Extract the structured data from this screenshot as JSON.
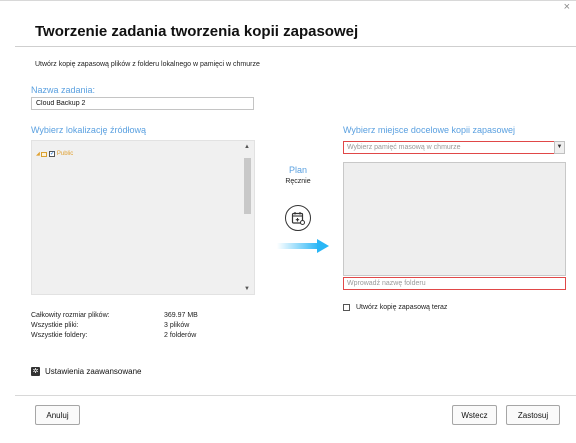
{
  "dialog": {
    "title": "Tworzenie zadania tworzenia kopii zapasowej",
    "subtitle": "Utwórz kopię zapasową plików z folderu lokalnego w pamięci w chmurze"
  },
  "task_name": {
    "label": "Nazwa zadania:",
    "value": "Cloud Backup 2"
  },
  "source": {
    "title": "Wybierz lokalizację źródłową",
    "tree": [
      {
        "label": "Public",
        "checked": true,
        "expanded": true
      }
    ]
  },
  "stats": {
    "rows": [
      {
        "key": "Całkowity rozmiar plików:",
        "value": "369.97 MB"
      },
      {
        "key": "Wszystkie pliki:",
        "value": "3 plików"
      },
      {
        "key": "Wszystkie foldery:",
        "value": "2 folderów"
      }
    ]
  },
  "advanced": {
    "label": "Ustawienia zaawansowane"
  },
  "plan": {
    "label": "Plan",
    "value": "Ręcznie"
  },
  "destination": {
    "title": "Wybierz miejsce docelowe kopii zapasowej",
    "storage_placeholder": "Wybierz pamięć masową w chmurze",
    "folder_placeholder": "Wprowadź nazwę folderu",
    "backup_now_label": "Utwórz kopię zapasową teraz"
  },
  "buttons": {
    "cancel": "Anuluj",
    "back": "Wstecz",
    "apply": "Zastosuj"
  },
  "colors": {
    "accent_blue": "#5aa0e0",
    "error_red": "#e04848",
    "arrow_cyan": "#29b6f6",
    "folder_orange": "#e0a030"
  },
  "icons": {
    "close": "close-icon",
    "calendar": "calendar-add-icon",
    "arrow": "arrow-right-icon",
    "gear": "gear-icon"
  }
}
